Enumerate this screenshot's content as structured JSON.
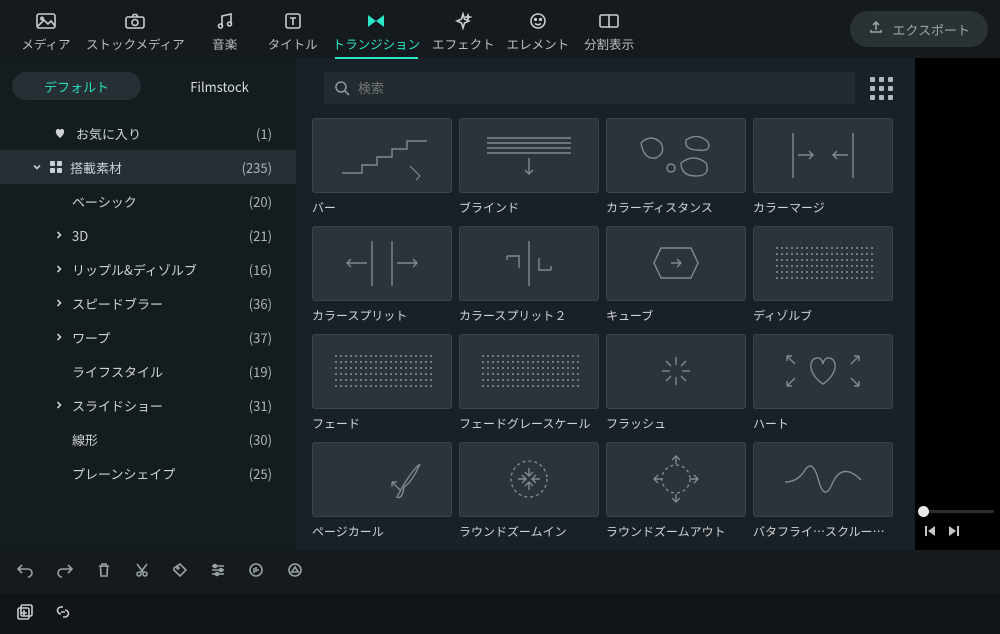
{
  "nav": {
    "items": [
      {
        "label": "メディア",
        "icon": "image"
      },
      {
        "label": "ストックメディア",
        "icon": "camera"
      },
      {
        "label": "音楽",
        "icon": "music"
      },
      {
        "label": "タイトル",
        "icon": "title"
      },
      {
        "label": "トランジション",
        "icon": "transition",
        "active": true
      },
      {
        "label": "エフェクト",
        "icon": "sparkle"
      },
      {
        "label": "エレメント",
        "icon": "face"
      },
      {
        "label": "分割表示",
        "icon": "split"
      }
    ],
    "export_label": "エクスポート"
  },
  "tabs": {
    "default": "デフォルト",
    "filmstock": "Filmstock"
  },
  "search": {
    "placeholder": "検索"
  },
  "categories": [
    {
      "name": "お気に入り",
      "count": "(1)",
      "prefix_icon": "heart",
      "caret": ""
    },
    {
      "name": "搭載素材",
      "count": "(235)",
      "prefix_icon": "grid",
      "caret": "down",
      "selected": true
    },
    {
      "name": "ベーシック",
      "count": "(20)",
      "caret": "",
      "indent": true
    },
    {
      "name": "3D",
      "count": "(21)",
      "caret": "right",
      "indent": true
    },
    {
      "name": "リップル&ディゾルブ",
      "count": "(16)",
      "caret": "right",
      "indent": true
    },
    {
      "name": "スピードブラー",
      "count": "(36)",
      "caret": "right",
      "indent": true,
      "arrow": true
    },
    {
      "name": "ワープ",
      "count": "(37)",
      "caret": "right",
      "indent": true
    },
    {
      "name": "ライフスタイル",
      "count": "(19)",
      "caret": "",
      "indent": true
    },
    {
      "name": "スライドショー",
      "count": "(31)",
      "caret": "right",
      "indent": true
    },
    {
      "name": "線形",
      "count": "(30)",
      "caret": "",
      "indent": true
    },
    {
      "name": "プレーンシェイプ",
      "count": "(25)",
      "caret": "",
      "indent": true
    }
  ],
  "tiles": [
    {
      "label": "バー",
      "icon": "bars"
    },
    {
      "label": "ブラインド",
      "icon": "blinds"
    },
    {
      "label": "カラーディスタンス",
      "icon": "blobs"
    },
    {
      "label": "カラーマージ",
      "icon": "colormerge"
    },
    {
      "label": "カラースプリット",
      "icon": "colorsplit"
    },
    {
      "label": "カラースプリット２",
      "icon": "colorsplit2"
    },
    {
      "label": "キューブ",
      "icon": "cube"
    },
    {
      "label": "ディゾルブ",
      "icon": "dots"
    },
    {
      "label": "フェード",
      "icon": "dots"
    },
    {
      "label": "フェードグレースケール",
      "icon": "dots"
    },
    {
      "label": "フラッシュ",
      "icon": "flash"
    },
    {
      "label": "ハート",
      "icon": "heart"
    },
    {
      "label": "ページカール",
      "icon": "pagecurl"
    },
    {
      "label": "ラウンドズームイン",
      "icon": "zoomin"
    },
    {
      "label": "ラウンドズームアウト",
      "icon": "zoomout"
    },
    {
      "label": "バタフライ…スクルーラー",
      "icon": "wave"
    }
  ]
}
